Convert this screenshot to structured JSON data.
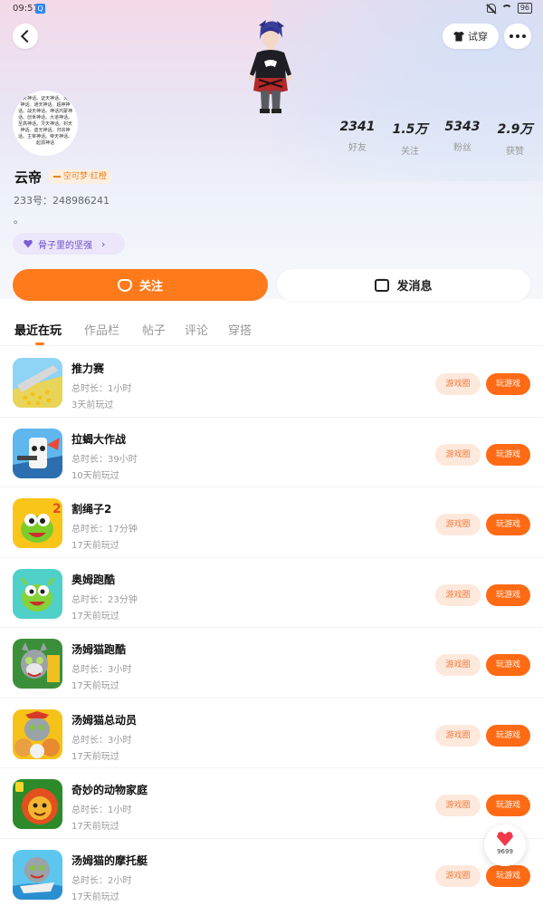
{
  "status_bar": {
    "time": "09:57",
    "app_badge": "Q",
    "battery": "96"
  },
  "header": {
    "try_on_label": "试穿"
  },
  "profile": {
    "avatar_text": "虎天神话。证天神话。天道神话。通天神话。超神神话。战天神话。神话鸿蒙神话。创世神话。大道神话。至高神话。灵天神话。封天神话。虚无神话。归宗神话。主宰神话。帝天神话。起源神话",
    "stats": [
      {
        "value": "2341",
        "label": "好友"
      },
      {
        "value": "1.5万",
        "label": "关注"
      },
      {
        "value": "5343",
        "label": "粉丝"
      },
      {
        "value": "2.9万",
        "label": "获赞"
      }
    ],
    "name": "云帝",
    "level_badge": "空可梦·红橙",
    "uid": "233号：248986241",
    "signature": "。",
    "tag_label": "骨子里的坚强",
    "follow_label": "关注",
    "message_label": "发消息"
  },
  "tabs": [
    "最近在玩",
    "作品栏",
    "帖子",
    "评论",
    "穿搭"
  ],
  "games": [
    {
      "name": "推力赛",
      "duration": "总时长：1小时",
      "last": "3天前玩过",
      "thumb": "crowd"
    },
    {
      "name": "拉蝎大作战",
      "duration": "总时长：39小时",
      "last": "10天前玩过",
      "thumb": "shooter"
    },
    {
      "name": "割绳子2",
      "duration": "总时长：17分钟",
      "last": "17天前玩过",
      "thumb": "omnom2"
    },
    {
      "name": "奥姆跑酷",
      "duration": "总时长：23分钟",
      "last": "17天前玩过",
      "thumb": "omrun"
    },
    {
      "name": "汤姆猫跑酷",
      "duration": "总时长：3小时",
      "last": "17天前玩过",
      "thumb": "tomrun"
    },
    {
      "name": "汤姆猫总动员",
      "duration": "总时长：3小时",
      "last": "17天前玩过",
      "thumb": "tomfriends"
    },
    {
      "name": "奇妙的动物家庭",
      "duration": "总时长：1小时",
      "last": "17天前玩过",
      "thumb": "lion"
    },
    {
      "name": "汤姆猫的摩托艇",
      "duration": "总时长：2小时",
      "last": "17天前玩过",
      "thumb": "tomjet"
    }
  ],
  "game_buttons": {
    "circle": "游戏圈",
    "play": "玩游戏"
  },
  "float_like": {
    "count": "9699"
  },
  "colors": {
    "accent": "#ff7a1a",
    "play": "#ff6a14",
    "circle_bg": "#fde8dc",
    "tag_purple": "#6a4fc7"
  }
}
